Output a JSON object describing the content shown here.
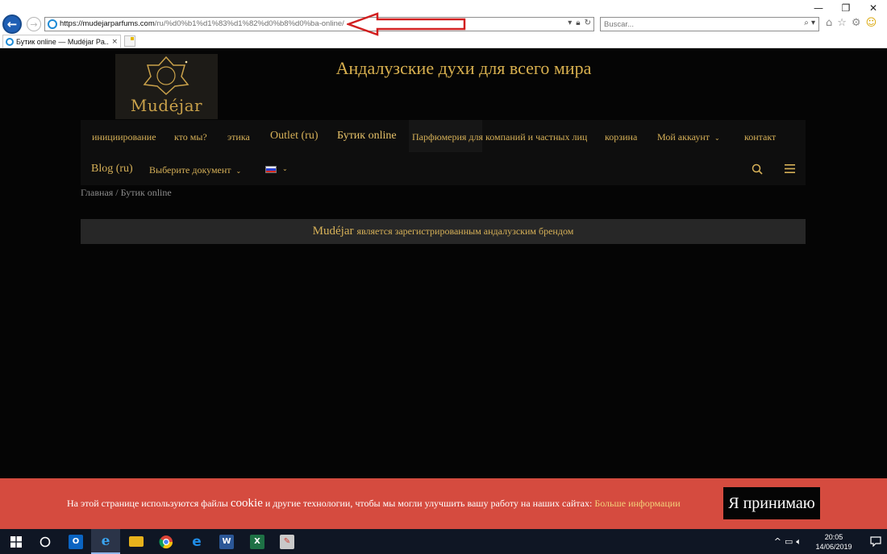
{
  "browser": {
    "url_host": "https://mudejarparfums.com",
    "url_path": "/ru/%d0%b1%d1%83%d1%82%d0%b8%d0%ba-online/",
    "search_placeholder": "Buscar...",
    "tab_title": "Бутик online — Mudéjar Pa...",
    "tab_close": "×",
    "window_controls": [
      "—",
      "❐",
      "✕"
    ],
    "toolbar_icons": [
      "home-icon",
      "star-icon",
      "gear-icon",
      "smiley-icon"
    ],
    "annotation_arrow_color": "#d11f1f"
  },
  "site": {
    "logo_text": "Mudéjar",
    "tagline": "Андалузские духи для всего мира",
    "accent_color": "#d7b158"
  },
  "nav": {
    "row1": [
      "инициирование",
      "кто мы?",
      "этика",
      "Outlet (ru)",
      "Бутик online",
      "Парфюмерия для компаний и частных лиц",
      "корзина",
      "Мой аккаунт",
      "контакт"
    ],
    "row2": [
      "Blog (ru)",
      "Выберите документ"
    ],
    "active": "Бутик online"
  },
  "breadcrumb": {
    "text": "Главная / Бутик online"
  },
  "banner": {
    "brand": "Mudéjar",
    "text": "является зарегистрированным андалузским брендом"
  },
  "cookie": {
    "text_before": "На этой странице используются файлы",
    "cookie_word": "cookie",
    "text_after": "и другие технологии, чтобы мы могли улучшить вашу работу на наших сайтах:",
    "link": "Больше информации",
    "accept": "Я принимаю",
    "bg_color": "#d54b3f"
  },
  "taskbar": {
    "apps": [
      "windows-start-icon",
      "cortana-icon",
      "outlook-icon",
      "internet-explorer-icon",
      "file-explorer-icon",
      "chrome-icon",
      "edge-icon",
      "word-icon",
      "excel-icon",
      "paint-icon"
    ],
    "time": "20:05",
    "date": "14/06/2019"
  }
}
